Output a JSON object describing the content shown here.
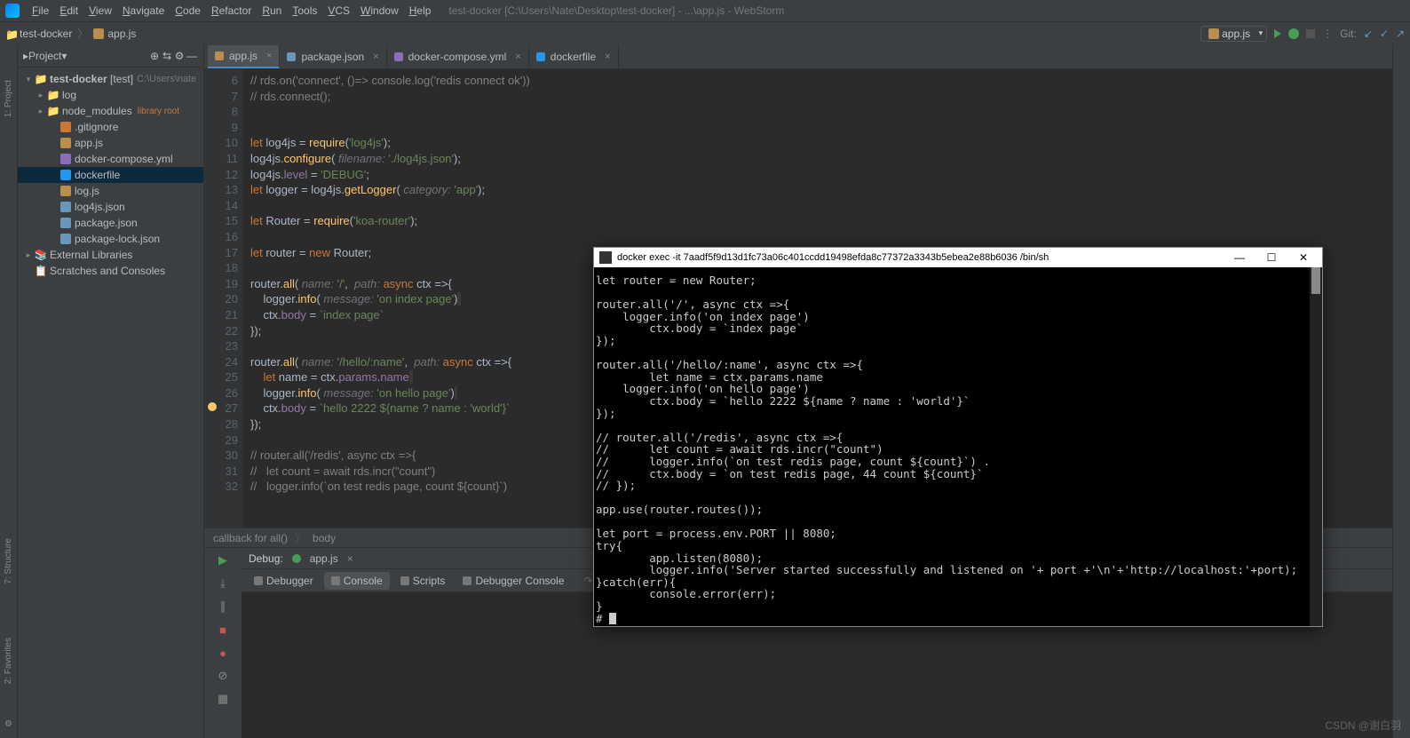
{
  "menu": {
    "items": [
      "File",
      "Edit",
      "View",
      "Navigate",
      "Code",
      "Refactor",
      "Run",
      "Tools",
      "VCS",
      "Window",
      "Help"
    ],
    "title": "test-docker [C:\\Users\\Nate\\Desktop\\test-docker] - ...\\app.js - WebStorm"
  },
  "nav": {
    "crumbs": [
      "test-docker",
      "app.js"
    ],
    "run_config": "app.js",
    "git_label": "Git:"
  },
  "sidebar": {
    "title": "Project",
    "root": {
      "name": "test-docker",
      "suffix": "[test]",
      "path": "C:\\Users\\nate"
    },
    "items": [
      {
        "icon": "folder",
        "label": "log",
        "indent": 1,
        "arrow": "▸"
      },
      {
        "icon": "folder",
        "label": "node_modules",
        "lib": "library root",
        "indent": 1,
        "arrow": "▸"
      },
      {
        "icon": "git",
        "label": ".gitignore",
        "indent": 2
      },
      {
        "icon": "js",
        "label": "app.js",
        "indent": 2
      },
      {
        "icon": "yml",
        "label": "docker-compose.yml",
        "indent": 2
      },
      {
        "icon": "dk",
        "label": "dockerfile",
        "indent": 2,
        "sel": true
      },
      {
        "icon": "js",
        "label": "log.js",
        "indent": 2
      },
      {
        "icon": "json",
        "label": "log4js.json",
        "indent": 2
      },
      {
        "icon": "json",
        "label": "package.json",
        "indent": 2
      },
      {
        "icon": "json",
        "label": "package-lock.json",
        "indent": 2
      }
    ],
    "ext_lib": "External Libraries",
    "scratch": "Scratches and Consoles"
  },
  "tabs": [
    {
      "label": "app.js",
      "icon": "js",
      "active": true
    },
    {
      "label": "package.json",
      "icon": "json"
    },
    {
      "label": "docker-compose.yml",
      "icon": "yml"
    },
    {
      "label": "dockerfile",
      "icon": "dk"
    }
  ],
  "gutter": {
    "start": 6,
    "end": 32,
    "bulb_line": 27
  },
  "crumbbar": {
    "a": "callback for all()",
    "b": "body"
  },
  "debug": {
    "label": "Debug:",
    "target": "app.js",
    "tabs": [
      "Debugger",
      "Console",
      "Scripts",
      "Debugger Console"
    ],
    "active": 1
  },
  "terminal": {
    "title": "docker  exec -it 7aadf5f9d13d1fc73a06c401ccdd19498efda8c77372a3343b5ebea2e88b6036 /bin/sh",
    "lines": [
      "let router = new Router;",
      "",
      "router.all('/', async ctx =>{",
      "    logger.info('on index page')",
      "        ctx.body = `index page`",
      "});",
      "",
      "router.all('/hello/:name', async ctx =>{",
      "        let name = ctx.params.name",
      "    logger.info('on hello page')",
      "        ctx.body = `hello 2222 ${name ? name : 'world'}`",
      "});",
      "",
      "// router.all('/redis', async ctx =>{",
      "//      let count = await rds.incr(\"count\")",
      "//      logger.info(`on test redis page, count ${count}`) .",
      "//      ctx.body = `on test redis page, 44 count ${count}`",
      "// });",
      "",
      "app.use(router.routes());",
      "",
      "let port = process.env.PORT || 8080;",
      "try{",
      "        app.listen(8080);",
      "        logger.info('Server started successfully and listened on '+ port +'\\n'+'http://localhost:'+port);",
      "}catch(err){",
      "        console.error(err);",
      "}",
      "# "
    ]
  },
  "watermark": "CSDN @谢白羽",
  "leftrail": [
    "1: Project",
    "2: Favorites",
    "7: Structure"
  ],
  "code_lines": [
    {
      "n": 6,
      "html": "<span class='cmt'>// rds.on('connect', ()=> console.log('redis connect ok'))</span>"
    },
    {
      "n": 7,
      "html": "<span class='cmt'>// rds.connect();</span>"
    },
    {
      "n": 8,
      "html": ""
    },
    {
      "n": 9,
      "html": ""
    },
    {
      "n": 10,
      "html": "<span class='kw'>let</span> log4js = <span class='fn'>require</span>(<span class='str'>'log4js'</span>);"
    },
    {
      "n": 11,
      "html": "log4js.<span class='fn'>configure</span>( <span class='param'>filename:</span> <span class='str'>'./log4js.json'</span>);"
    },
    {
      "n": 12,
      "html": "log4js.<span class='prop'>level</span> = <span class='str'>'DEBUG'</span>;"
    },
    {
      "n": 13,
      "html": "<span class='kw'>let</span> logger = log4js.<span class='fn'>getLogger</span>( <span class='param'>category:</span> <span class='str'>'app'</span>);"
    },
    {
      "n": 14,
      "html": ""
    },
    {
      "n": 15,
      "html": "<span class='kw'>let</span> Router = <span class='fn'>require</span>(<span class='str'>'koa-router'</span>);"
    },
    {
      "n": 16,
      "html": ""
    },
    {
      "n": 17,
      "html": "<span class='kw'>let</span> router = <span class='kw'>new</span> Router;"
    },
    {
      "n": 18,
      "html": ""
    },
    {
      "n": 19,
      "html": "router.<span class='fn'>all</span>( <span class='param'>name:</span> <span class='str'>'/'</span>,  <span class='param'>path:</span> <span class='kw'>async</span> ctx =&gt;{"
    },
    {
      "n": 20,
      "html": "    logger.<span class='fn'>info</span>( <span class='param'>message:</span> <span class='str'>'on index page'</span>)<span class='hl'>&nbsp;</span>"
    },
    {
      "n": 21,
      "html": "    ctx.<span class='prop'>body</span> = <span class='tmpl'>`index page`</span>"
    },
    {
      "n": 22,
      "html": "});"
    },
    {
      "n": 23,
      "html": ""
    },
    {
      "n": 24,
      "html": "router.<span class='fn'>all</span>( <span class='param'>name:</span> <span class='str'>'/hello/:name'</span>,  <span class='param'>path:</span> <span class='kw'>async</span> ctx =&gt;{"
    },
    {
      "n": 25,
      "html": "    <span class='kw'>let</span> name = ctx.<span class='prop'>params</span>.<span class='prop'>name</span><span class='hl'>&nbsp;</span>"
    },
    {
      "n": 26,
      "html": "    logger.<span class='fn'>info</span>( <span class='param'>message:</span> <span class='str'>'on hello page'</span>)<span class='hl'>&nbsp;</span>"
    },
    {
      "n": 27,
      "html": "    ctx.<span class='prop'>body</span> = <span class='tmpl'>`hello 2222 ${name ? name : 'world'}`</span>"
    },
    {
      "n": 28,
      "html": "});"
    },
    {
      "n": 29,
      "html": ""
    },
    {
      "n": 30,
      "html": "<span class='cmt'>// router.all('/redis', async ctx =&gt;{</span>"
    },
    {
      "n": 31,
      "html": "<span class='cmt'>//   let count = await rds.incr(\"count\")</span>"
    },
    {
      "n": 32,
      "html": "<span class='cmt'>//   logger.info(`on test redis page, count ${count}`)</span>"
    }
  ]
}
